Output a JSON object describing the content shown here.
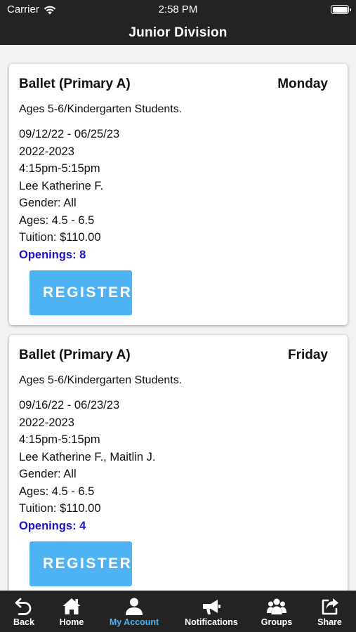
{
  "status_bar": {
    "carrier": "Carrier",
    "time": "2:58 PM"
  },
  "nav": {
    "title": "Junior Division"
  },
  "classes": [
    {
      "name": "Ballet (Primary A)",
      "day": "Monday",
      "description": "Ages 5-6/Kindergarten Students.",
      "dates": "09/12/22 - 06/25/23",
      "season": "2022-2023",
      "time": "4:15pm-5:15pm",
      "instructor": "Lee Katherine F.",
      "gender": "Gender: All",
      "ages": "Ages: 4.5 - 6.5",
      "tuition": "Tuition: $110.00",
      "openings": "Openings: 8",
      "register_label": "REGISTER"
    },
    {
      "name": "Ballet (Primary A)",
      "day": "Friday",
      "description": "Ages 5-6/Kindergarten Students.",
      "dates": "09/16/22 - 06/23/23",
      "season": "2022-2023",
      "time": "4:15pm-5:15pm",
      "instructor": "Lee Katherine F., Maitlin J.",
      "gender": "Gender: All",
      "ages": "Ages: 4.5 - 6.5",
      "tuition": "Tuition: $110.00",
      "openings": "Openings: 4",
      "register_label": "REGISTER"
    }
  ],
  "tabbar": {
    "items": [
      {
        "label": "Back",
        "icon": "back-arrow-icon"
      },
      {
        "label": "Home",
        "icon": "home-icon"
      },
      {
        "label": "My Account",
        "icon": "person-icon",
        "active": true
      },
      {
        "label": "Notifications",
        "icon": "megaphone-icon"
      },
      {
        "label": "Groups",
        "icon": "groups-icon"
      },
      {
        "label": "Share",
        "icon": "share-icon"
      }
    ]
  },
  "colors": {
    "bar_background": "#232323",
    "accent": "#4db3f3",
    "openings": "#1a14c9",
    "page_background": "#f2f2f2"
  }
}
